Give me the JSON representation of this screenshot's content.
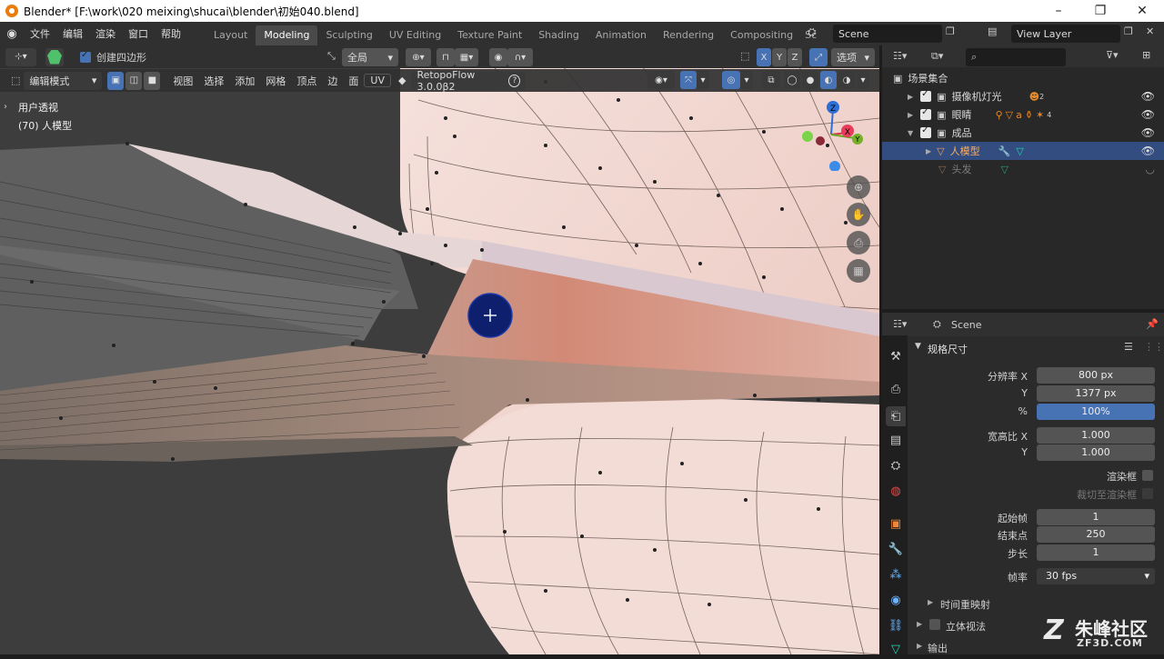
{
  "window": {
    "title": "Blender* [F:\\work\\020 meixing\\shucai\\blender\\初始040.blend]",
    "minimize": "–",
    "maximize": "❐",
    "close": "✕"
  },
  "menubar": {
    "items": [
      "文件",
      "编辑",
      "渲染",
      "窗口",
      "帮助"
    ]
  },
  "workspaces": {
    "tabs": [
      "Layout",
      "Modeling",
      "Sculpting",
      "UV Editing",
      "Texture Paint",
      "Shading",
      "Animation",
      "Rendering",
      "Compositing",
      "Sc"
    ],
    "active": "Modeling"
  },
  "scene": {
    "name": "Scene",
    "view_layer": "View Layer"
  },
  "tool_header": {
    "create_quad": "创建四边形",
    "transform_orientation": "全局",
    "options": "选项",
    "axes": [
      "X",
      "Y",
      "Z"
    ]
  },
  "viewport_header": {
    "mode": "编辑模式",
    "menus": [
      "视图",
      "选择",
      "添加",
      "网格",
      "顶点",
      "边",
      "面",
      "UV"
    ],
    "addon": "RetopoFlow 3.0.0β2",
    "help": "?"
  },
  "viewport": {
    "view_name": "用户透视",
    "object_info": "(70) 人模型",
    "gizmo_labels": [
      "Z",
      "X",
      "Y"
    ]
  },
  "outliner": {
    "search_placeholder": "",
    "root": "场景集合",
    "rows": [
      {
        "label": "摄像机灯光",
        "badge": "2"
      },
      {
        "label": "眼睛",
        "badge": "4"
      },
      {
        "label": "成品",
        "badge": ""
      },
      {
        "label": "人模型",
        "badge": ""
      },
      {
        "label": "头发",
        "badge": ""
      }
    ]
  },
  "properties": {
    "header_scene": "Scene",
    "section": "规格尺寸",
    "resolution_x_label": "分辨率 X",
    "resolution_x": "800 px",
    "resolution_y_label": "Y",
    "resolution_y": "1377 px",
    "percent_label": "%",
    "percent": "100%",
    "aspect_x_label": "宽高比 X",
    "aspect_x": "1.000",
    "aspect_y_label": "Y",
    "aspect_y": "1.000",
    "render_region": "渲染框",
    "crop_region": "裁切至渲染框",
    "frame_start_label": "起始帧",
    "frame_start": "1",
    "frame_end_label": "结束点",
    "frame_end": "250",
    "frame_step_label": "步长",
    "frame_step": "1",
    "frame_rate_label": "帧率",
    "frame_rate": "30 fps",
    "time_remap": "时间重映射",
    "stereoscopy": "立体视法",
    "output": "输出"
  },
  "watermark": {
    "brand": "朱峰社区",
    "site": "ZF3D.COM"
  }
}
